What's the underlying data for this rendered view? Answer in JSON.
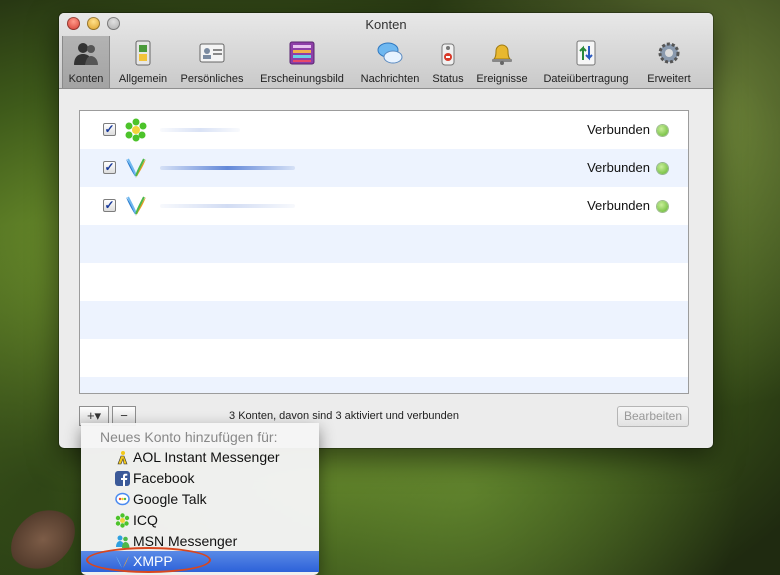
{
  "window": {
    "title": "Konten"
  },
  "toolbar": {
    "items": [
      {
        "label": "Konten",
        "icon": "people-icon",
        "selected": true
      },
      {
        "label": "Allgemein",
        "icon": "switch-icon"
      },
      {
        "label": "Persönliches",
        "icon": "id-card-icon"
      },
      {
        "label": "Erscheinungsbild",
        "icon": "appearance-icon"
      },
      {
        "label": "Nachrichten",
        "icon": "chat-bubbles-icon"
      },
      {
        "label": "Status",
        "icon": "status-tag-icon"
      },
      {
        "label": "Ereignisse",
        "icon": "bell-icon"
      },
      {
        "label": "Dateiübertragung",
        "icon": "file-transfer-icon"
      },
      {
        "label": "Erweitert",
        "icon": "gear-icon"
      }
    ]
  },
  "accounts": [
    {
      "enabled": true,
      "service_icon": "icq-flower-icon",
      "status": "Verbunden"
    },
    {
      "enabled": true,
      "service_icon": "xmpp-icon",
      "status": "Verbunden"
    },
    {
      "enabled": true,
      "service_icon": "xmpp-icon",
      "status": "Verbunden"
    }
  ],
  "footer": {
    "add_label": "+▾",
    "remove_label": "−",
    "summary": "3 Konten, davon sind 3 aktiviert und verbunden",
    "edit_label": "Bearbeiten"
  },
  "menu": {
    "header": "Neues Konto hinzufügen für:",
    "items": [
      {
        "label": "AOL Instant Messenger",
        "icon": "aim-icon"
      },
      {
        "label": "Facebook",
        "icon": "facebook-icon"
      },
      {
        "label": "Google Talk",
        "icon": "google-talk-icon"
      },
      {
        "label": "ICQ",
        "icon": "icq-icon"
      },
      {
        "label": "MSN Messenger",
        "icon": "msn-icon"
      },
      {
        "label": "XMPP",
        "icon": "xmpp-icon",
        "highlighted": true
      }
    ]
  },
  "colors": {
    "status_green": "#5fb32a",
    "highlight_blue": "#2d62d9",
    "annotation_red": "#d8461e"
  }
}
